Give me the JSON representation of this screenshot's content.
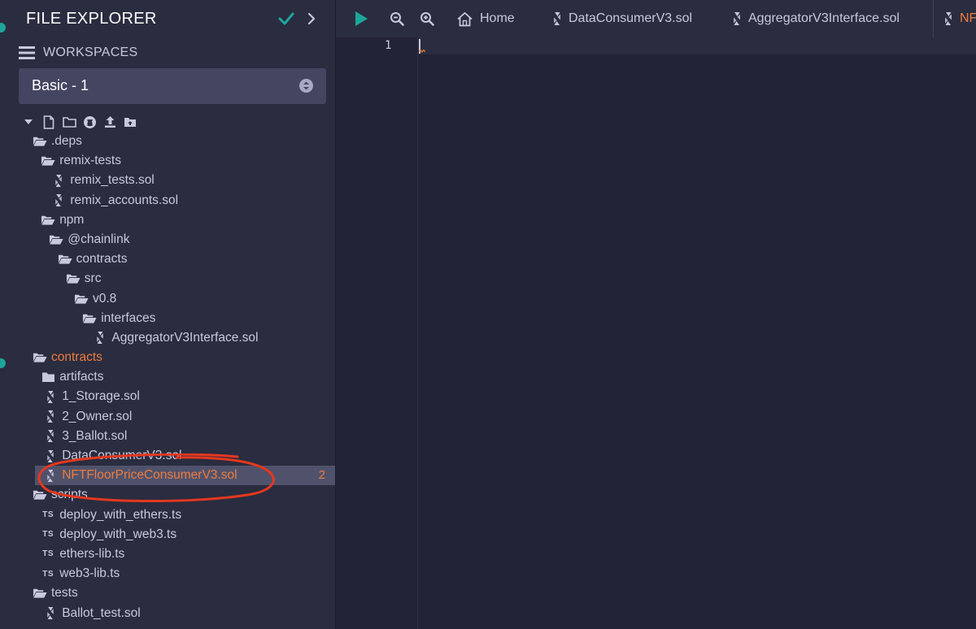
{
  "panel": {
    "title": "FILE EXPLORER",
    "workspaces_label": "WORKSPACES",
    "workspace_selected": "Basic - 1"
  },
  "tree": [
    {
      "label": ".deps",
      "type": "folder-open",
      "indent": 0
    },
    {
      "label": "remix-tests",
      "type": "folder-open",
      "indent": 1
    },
    {
      "label": "remix_tests.sol",
      "type": "sol",
      "indent": 2
    },
    {
      "label": "remix_accounts.sol",
      "type": "sol",
      "indent": 2
    },
    {
      "label": "npm",
      "type": "folder-open",
      "indent": 1
    },
    {
      "label": "@chainlink",
      "type": "folder-open",
      "indent": 2
    },
    {
      "label": "contracts",
      "type": "folder-open",
      "indent": 3
    },
    {
      "label": "src",
      "type": "folder-open",
      "indent": 4
    },
    {
      "label": "v0.8",
      "type": "folder-open",
      "indent": 5
    },
    {
      "label": "interfaces",
      "type": "folder-open",
      "indent": 6
    },
    {
      "label": "AggregatorV3Interface.sol",
      "type": "sol",
      "indent": 7
    },
    {
      "label": "contracts",
      "type": "folder-open",
      "indent": 0,
      "active": true
    },
    {
      "label": "artifacts",
      "type": "folder",
      "indent": 1
    },
    {
      "label": "1_Storage.sol",
      "type": "sol",
      "indent": 1
    },
    {
      "label": "2_Owner.sol",
      "type": "sol",
      "indent": 1
    },
    {
      "label": "3_Ballot.sol",
      "type": "sol",
      "indent": 1
    },
    {
      "label": "DataConsumerV3.sol",
      "type": "sol",
      "indent": 1
    },
    {
      "label": "NFTFloorPriceConsumerV3.sol",
      "type": "sol",
      "indent": 1,
      "selected": true,
      "badge": "2"
    },
    {
      "label": "scripts",
      "type": "folder-open",
      "indent": 0
    },
    {
      "label": "deploy_with_ethers.ts",
      "type": "ts",
      "indent": 1
    },
    {
      "label": "deploy_with_web3.ts",
      "type": "ts",
      "indent": 1
    },
    {
      "label": "ethers-lib.ts",
      "type": "ts",
      "indent": 1
    },
    {
      "label": "web3-lib.ts",
      "type": "ts",
      "indent": 1
    },
    {
      "label": "tests",
      "type": "folder-open",
      "indent": 0
    },
    {
      "label": "Ballot_test.sol",
      "type": "sol",
      "indent": 1
    }
  ],
  "tabs": {
    "home": "Home",
    "file1": "DataConsumerV3.sol",
    "file2": "AggregatorV3Interface.sol",
    "file3": "NF"
  },
  "ts_badge": "TS",
  "editor": {
    "line_number": "1"
  },
  "colors": {
    "accent": "#ec7c3f",
    "success": "#1ea59a",
    "annotation": "#e4381f"
  }
}
